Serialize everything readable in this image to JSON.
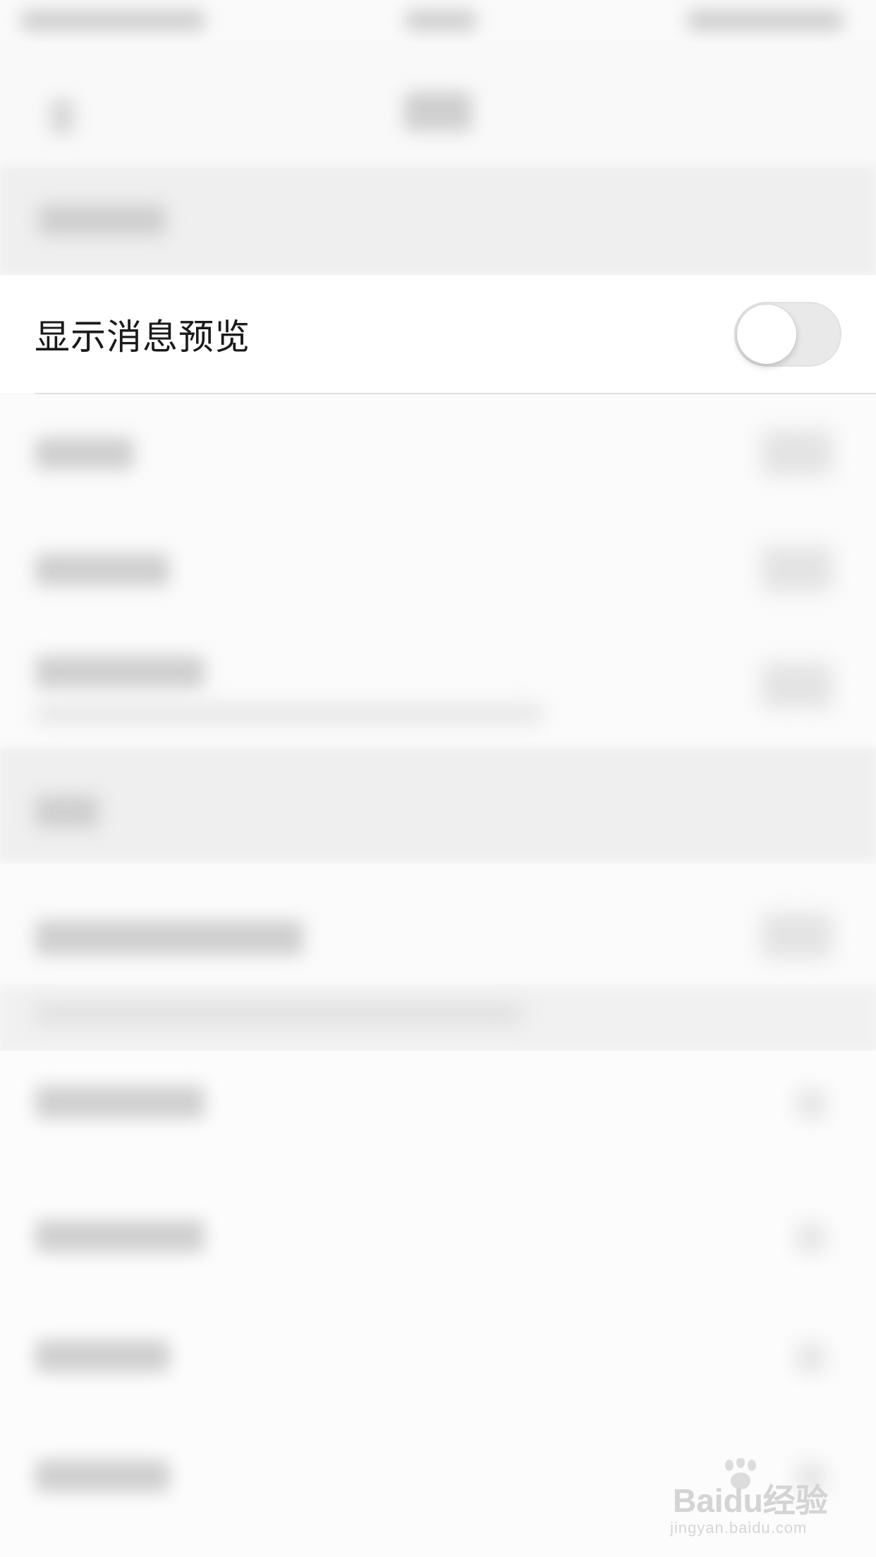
{
  "settings": {
    "preview_label": "显示消息预览",
    "preview_enabled": false
  },
  "watermark": {
    "brand": "Baidu经验",
    "url": "jingyan.baidu.com"
  }
}
